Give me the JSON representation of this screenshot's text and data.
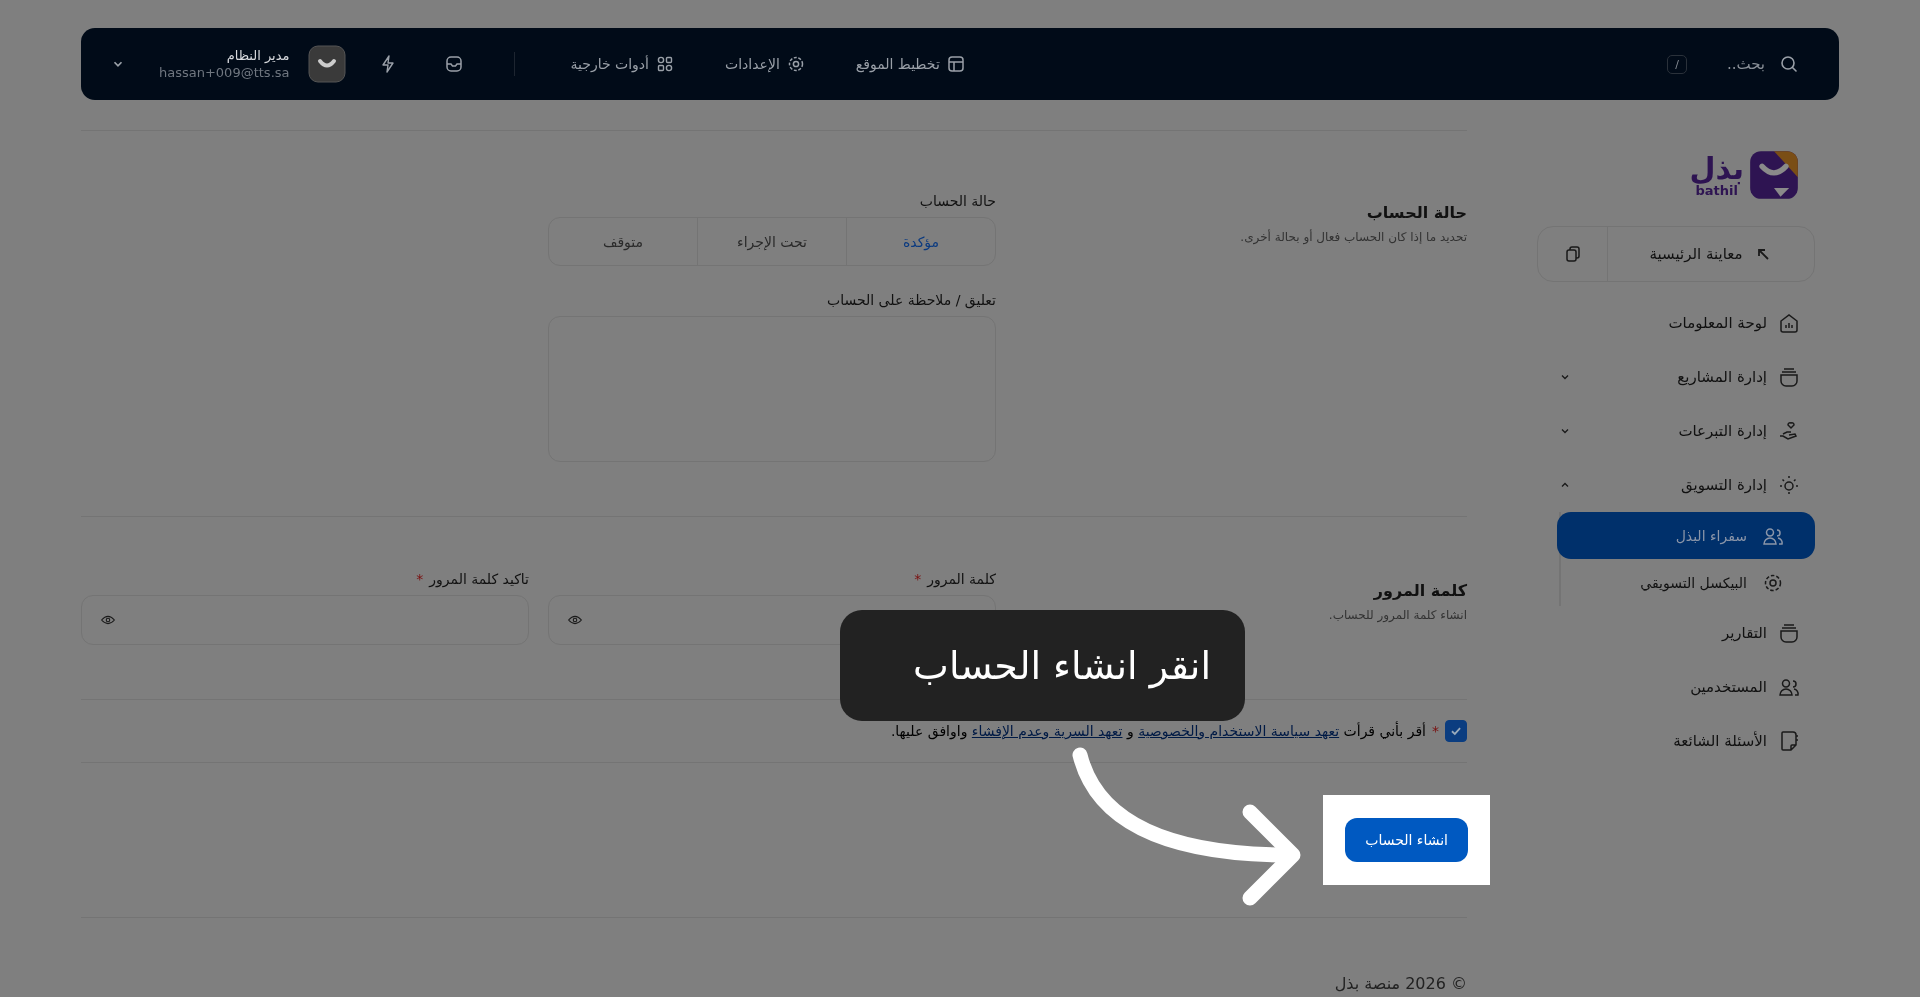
{
  "topbar": {
    "search_placeholder": "بحث..",
    "shortcut": "/",
    "links": [
      {
        "label": "تخطيط الموقع"
      },
      {
        "label": "الإعدادات"
      },
      {
        "label": "أدوات خارجية"
      }
    ],
    "user": {
      "name": "مدير النظام",
      "email": "hassan+009@tts.sa"
    }
  },
  "sidebar": {
    "logo_text": "بذل",
    "logo_subtext": "bathil",
    "preview_button": "معاينة الرئيسية",
    "items": [
      {
        "label": "لوحة المعلومات",
        "selected": false
      },
      {
        "label": "إدارة المشاريع",
        "selected": false,
        "expanded": false
      },
      {
        "label": "إدارة التبرعات",
        "selected": false,
        "expanded": false
      },
      {
        "label": "إدارة التسويق",
        "selected": false,
        "expanded": true,
        "children": [
          {
            "label": "سفراء البذل",
            "selected": true
          },
          {
            "label": "البيكسل التسويقي",
            "selected": false
          }
        ]
      },
      {
        "label": "التقارير",
        "selected": false
      },
      {
        "label": "المستخدمين",
        "selected": false
      },
      {
        "label": "الأسئلة الشائعة",
        "selected": false
      }
    ]
  },
  "account_status": {
    "title": "حالة الحساب",
    "description": "تحديد ما إذا كان الحساب فعال أو بحالة أخرى.",
    "status_label": "حالة الحساب",
    "options": [
      {
        "label": "مؤكدة",
        "selected": true
      },
      {
        "label": "تحت الإجراء",
        "selected": false
      },
      {
        "label": "متوقف",
        "selected": false
      }
    ],
    "comment_label": "تعليق / ملاحظة على الحساب"
  },
  "password": {
    "title": "كلمة المرور",
    "description": "انشاء كلمة المرور للحساب.",
    "fields": [
      {
        "label": "كلمة المرور",
        "required_mark": "*"
      },
      {
        "label": "تاكيد كلمة المرور",
        "required_mark": "*"
      }
    ]
  },
  "agreement": {
    "checked": true,
    "required_mark": "*",
    "text_before": "أقر بأني قرأت",
    "link_1": "تعهد سياسة الاستخدام والخصوصية",
    "joiner": "و",
    "link_2": "تعهد السرية وعدم الإفشاء",
    "text_after": "واوافق عليها."
  },
  "submit_button": "انشاء الحساب",
  "tooltip": "انقر انشاء الحساب",
  "footer": "© 2026 منصة بذل"
}
